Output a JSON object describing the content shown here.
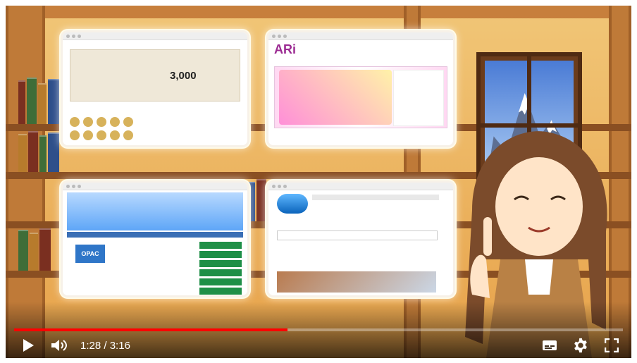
{
  "player": {
    "time_current": "1:28",
    "time_separator": " / ",
    "time_total": "3:16",
    "progress_fraction": 0.449,
    "colors": {
      "progress": "#ff0000",
      "text": "#ffffff"
    },
    "icons": [
      "play-icon",
      "volume-icon",
      "subtitles-icon",
      "settings-icon",
      "fullscreen-icon"
    ]
  },
  "thumbnails": {
    "t1_price": "3,000",
    "t2_logo": "ARi",
    "t3_opac": "OPAC"
  }
}
